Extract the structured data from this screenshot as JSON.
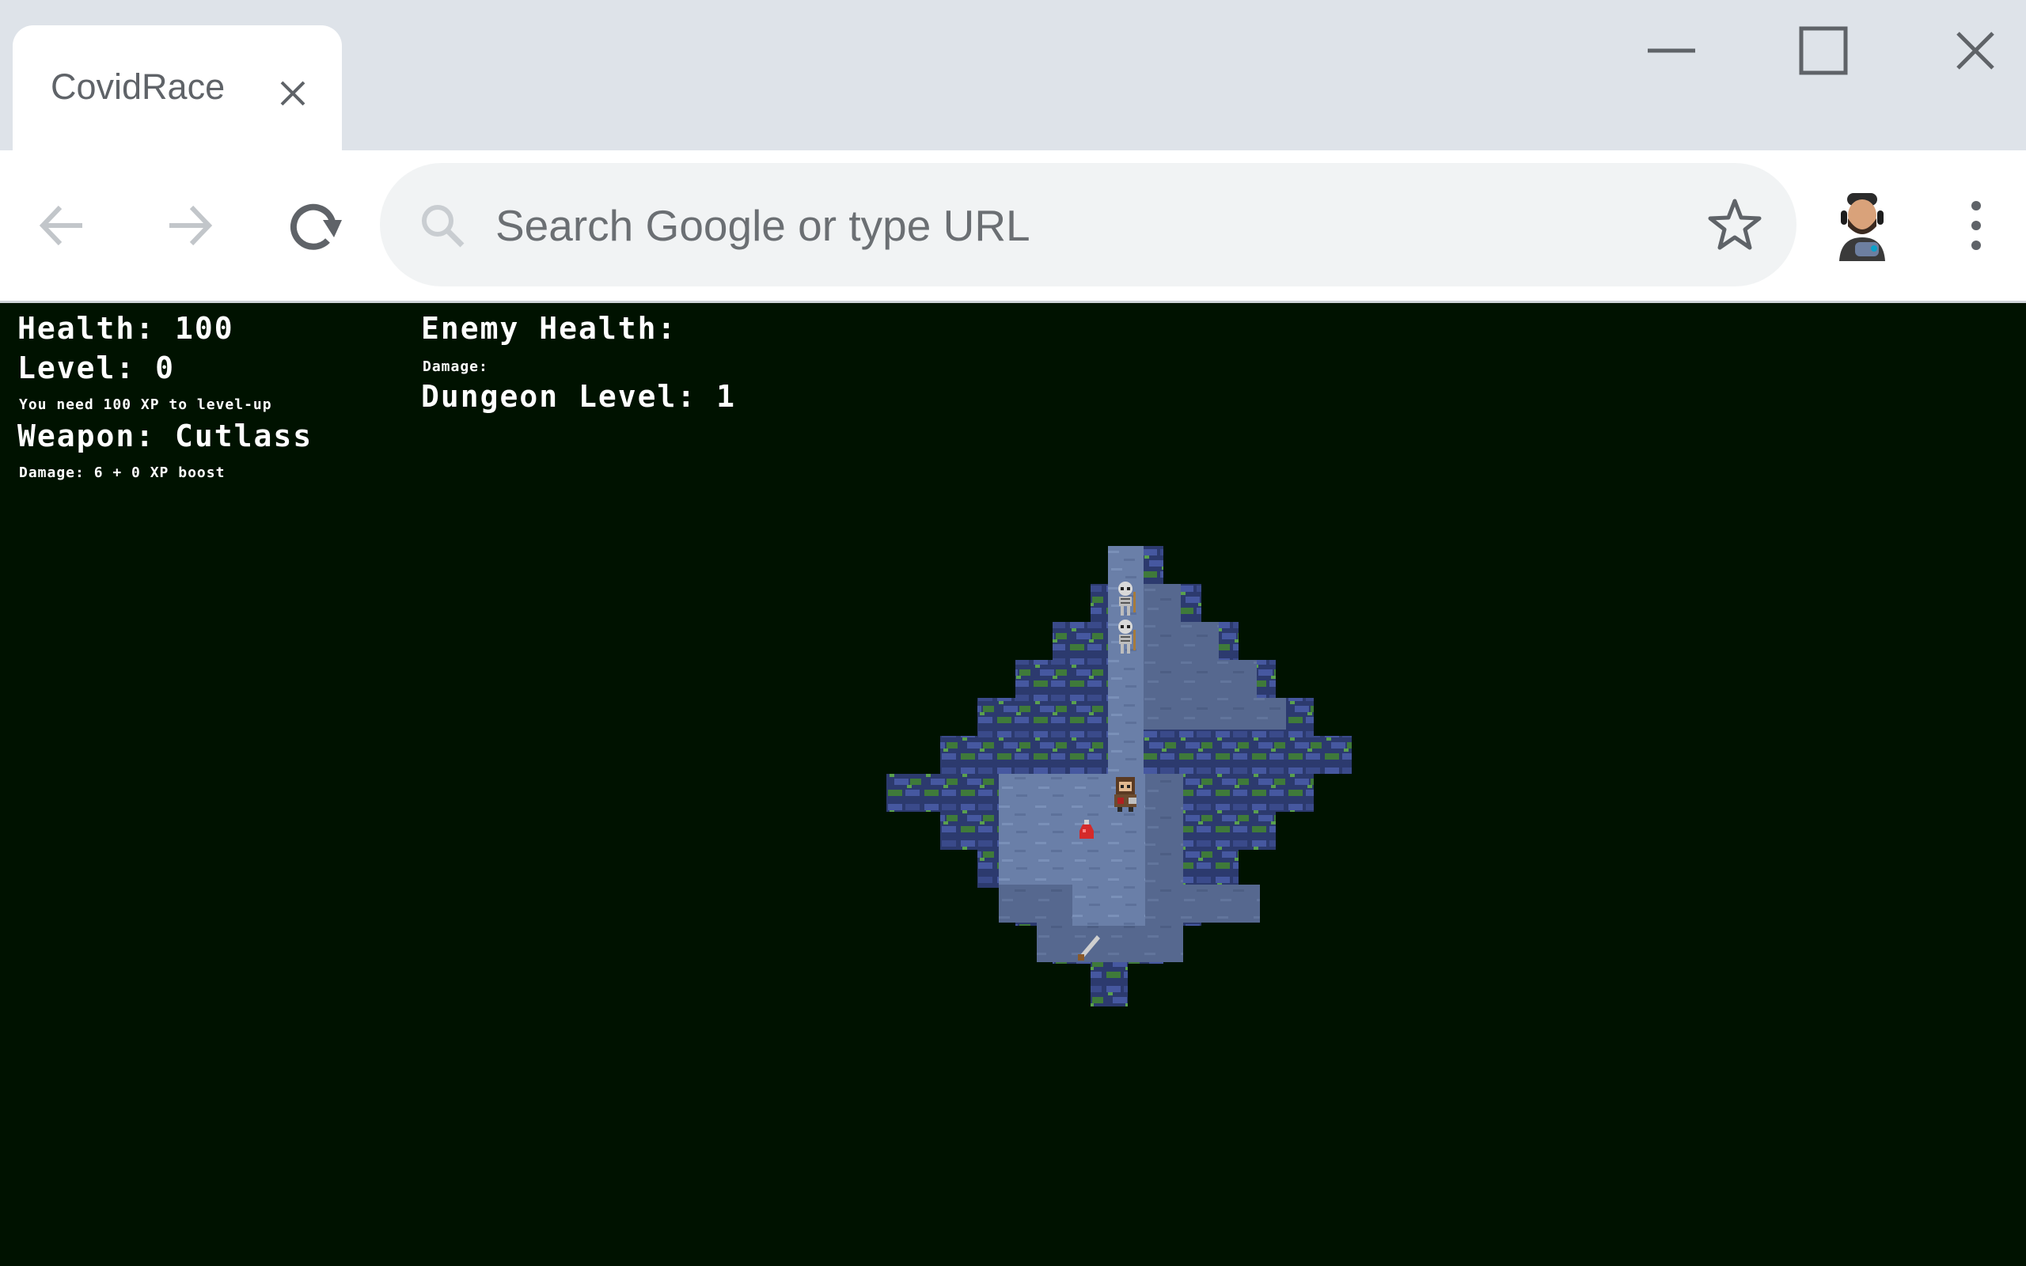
{
  "browser": {
    "tab_title": "CovidRace",
    "omnibox_placeholder": "Search Google or type URL"
  },
  "hud": {
    "health": "Health: 100",
    "level": "Level: 0",
    "xp_needed": "You need 100 XP to level-up",
    "weapon": "Weapon: Cutlass",
    "weapon_damage": "Damage: 6 + 0 XP boost",
    "enemy_health": "Enemy Health:",
    "enemy_damage": "Damage:",
    "dungeon_level": "Dungeon Level: 1"
  },
  "colors": {
    "game_background": "#001200",
    "floor": "#6a7fa8",
    "wall": "#2c3a6e",
    "moss": "#3f7a3a"
  },
  "sprites": [
    "skeleton-enemy",
    "skeleton-enemy",
    "player",
    "health-potion",
    "sword-weapon"
  ]
}
